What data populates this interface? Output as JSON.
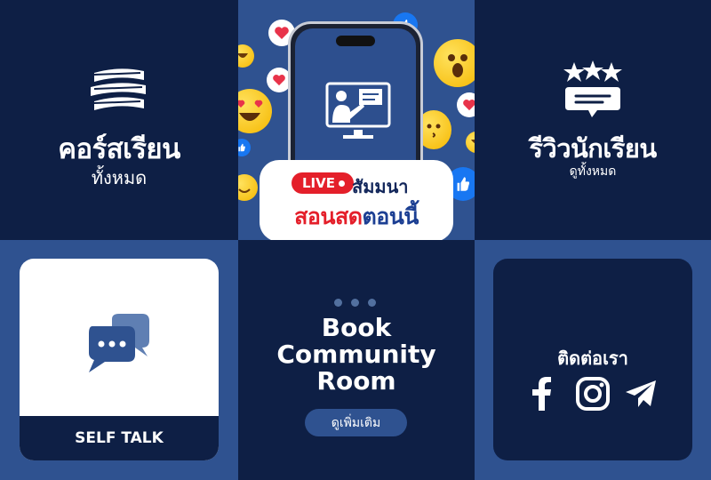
{
  "tiles": {
    "courses": {
      "title": "คอร์สเรียน",
      "subtitle": "ทั้งหมด"
    },
    "live": {
      "badge": "LIVE",
      "line1": "สัมมนา",
      "line2_red": "สอนสด",
      "line2_blue": "ตอนนี้"
    },
    "reviews": {
      "title": "รีวิวนักเรียน",
      "subtitle": "ดูทั้งหมด"
    },
    "selftalk": {
      "label": "SELF TALK"
    },
    "book": {
      "title_line1": "Book",
      "title_line2": "Community",
      "title_line3": "Room",
      "button": "ดูเพิ่มเติม"
    },
    "contact": {
      "title": "ติดต่อเรา"
    }
  },
  "colors": {
    "navy": "#0e1f45",
    "blue": "#2f5290",
    "red": "#e41f2a",
    "white": "#ffffff"
  },
  "icons": [
    "books-icon",
    "teacher-screen-icon",
    "review-stars-icon",
    "chat-bubbles-icon",
    "facebook-icon",
    "instagram-icon",
    "telegram-icon"
  ]
}
